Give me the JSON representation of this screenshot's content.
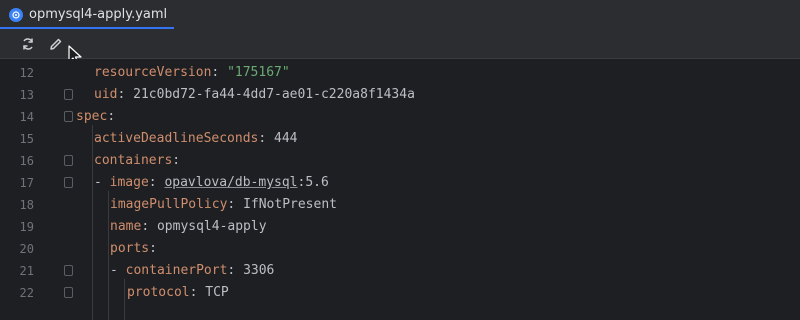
{
  "tab": {
    "title": "opmysql4-apply.yaml",
    "icon": "kubernetes-icon"
  },
  "toolbar": {
    "buttons": [
      {
        "name": "refresh-icon"
      },
      {
        "name": "edit-icon"
      }
    ]
  },
  "colors": {
    "key": "#cf8e6d",
    "string": "#6aab73",
    "text": "#bcbec4",
    "line_number": "#6f737a",
    "accent": "#3574f0"
  },
  "lines": [
    {
      "num": "12",
      "key": "resourceVersion",
      "sep": ": ",
      "value": "\"175167\"",
      "value_type": "string",
      "prefix": ""
    },
    {
      "num": "13",
      "key": "uid",
      "sep": ": ",
      "value": "21c0bd72-fa44-4dd7-ae01-c220a8f1434a",
      "value_type": "plain",
      "prefix": ""
    },
    {
      "num": "14",
      "key": "spec",
      "sep": ":",
      "value": "",
      "value_type": "plain",
      "prefix": ""
    },
    {
      "num": "15",
      "key": "activeDeadlineSeconds",
      "sep": ": ",
      "value": "444",
      "value_type": "plain",
      "prefix": ""
    },
    {
      "num": "16",
      "key": "containers",
      "sep": ":",
      "value": "",
      "value_type": "plain",
      "prefix": ""
    },
    {
      "num": "17",
      "key": "image",
      "sep": ": ",
      "value_link": "opavlova/db-mysql",
      "value": ":5.6",
      "value_type": "plain",
      "prefix": "- "
    },
    {
      "num": "18",
      "key": "imagePullPolicy",
      "sep": ": ",
      "value": "IfNotPresent",
      "value_type": "plain",
      "prefix": ""
    },
    {
      "num": "19",
      "key": "name",
      "sep": ": ",
      "value": "opmysql4-apply",
      "value_type": "plain",
      "prefix": ""
    },
    {
      "num": "20",
      "key": "ports",
      "sep": ":",
      "value": "",
      "value_type": "plain",
      "prefix": ""
    },
    {
      "num": "21",
      "key": "containerPort",
      "sep": ": ",
      "value": "3306",
      "value_type": "plain",
      "prefix": "- "
    },
    {
      "num": "22",
      "key": "protocol",
      "sep": ": ",
      "value": "TCP",
      "value_type": "plain",
      "prefix": ""
    }
  ]
}
